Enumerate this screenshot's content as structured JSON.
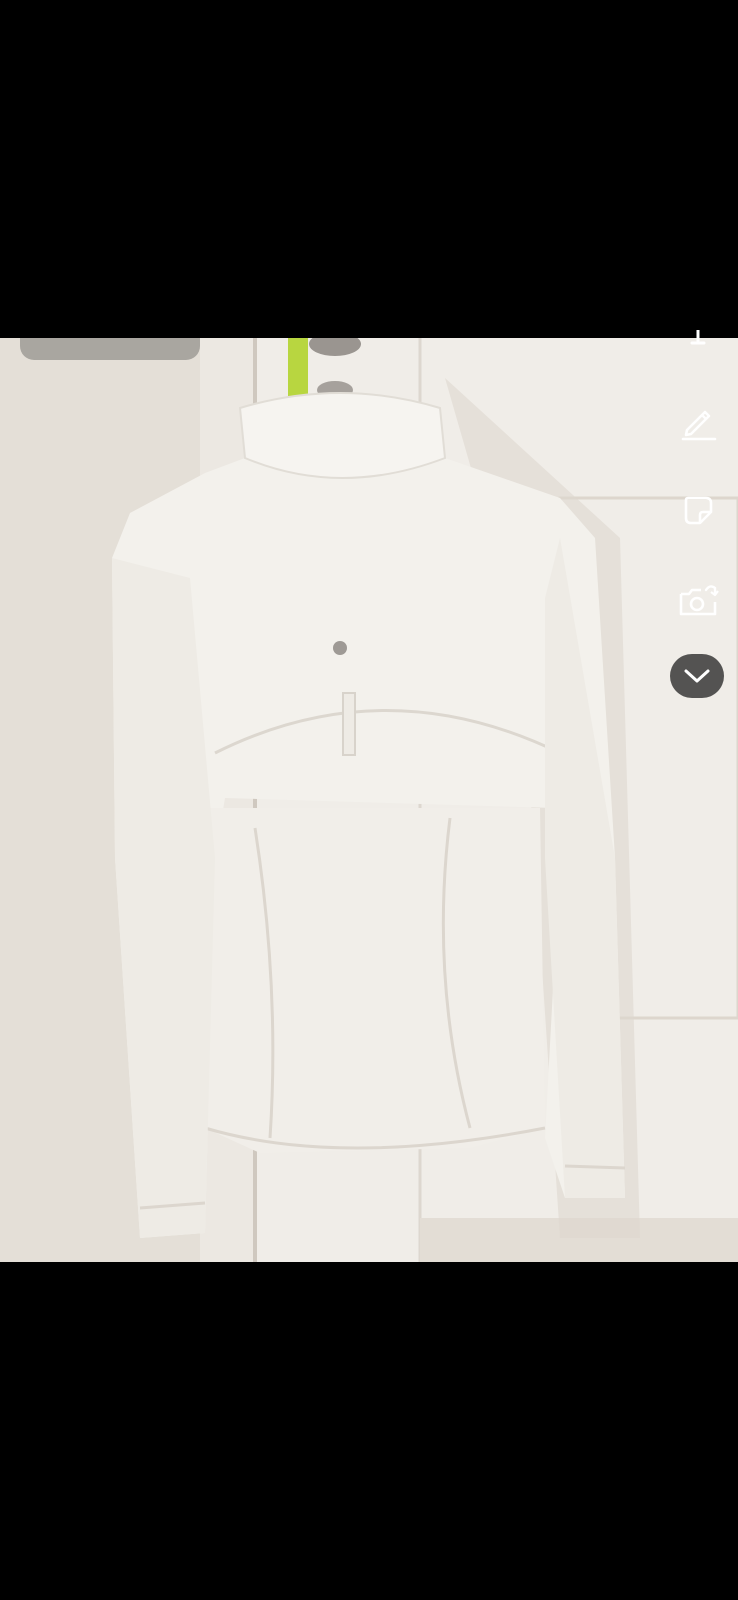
{
  "editor": {
    "tools": [
      {
        "name": "text",
        "icon": "text-icon"
      },
      {
        "name": "draw",
        "icon": "pen-icon"
      },
      {
        "name": "sticker",
        "icon": "sticker-icon"
      },
      {
        "name": "camera",
        "icon": "camera-flip-icon"
      },
      {
        "name": "more",
        "icon": "chevron-down-icon"
      }
    ]
  },
  "colors": {
    "letterbox": "#000000",
    "icon": "#ffffff",
    "collapse_button_bg": "#2a2a2a"
  }
}
